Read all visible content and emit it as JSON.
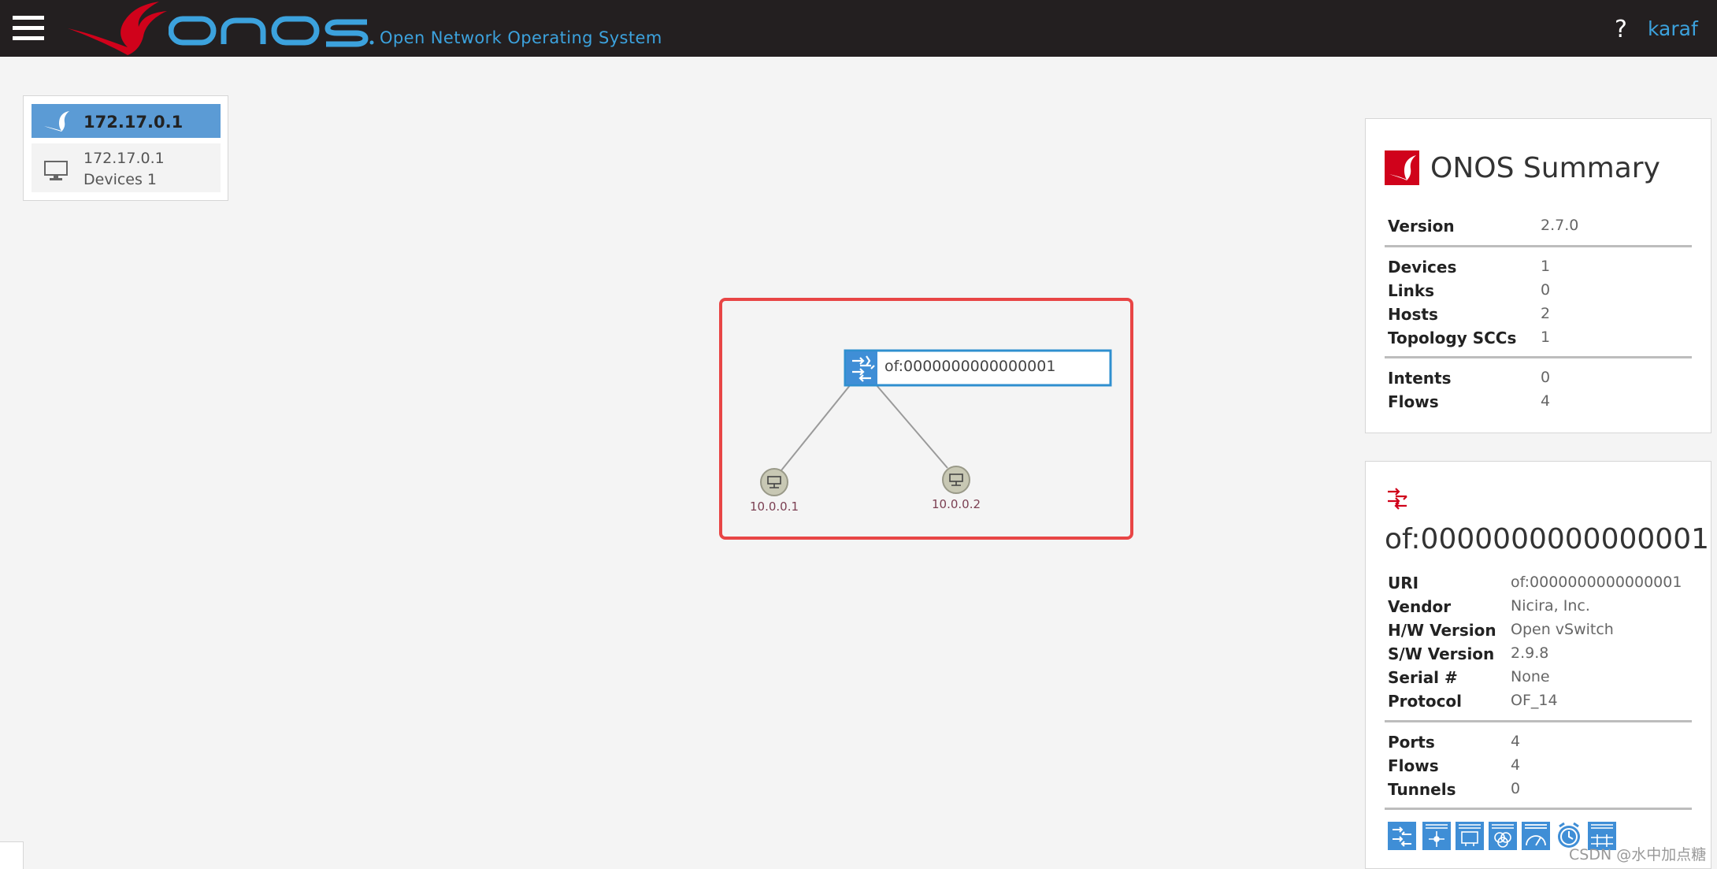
{
  "header": {
    "logo_text": "onos",
    "subtitle": "Open Network Operating System",
    "help_label": "?",
    "user": "karaf"
  },
  "instance": {
    "title": "172.17.0.1",
    "ip": "172.17.0.1",
    "devices": "Devices 1"
  },
  "topology": {
    "device_label": "of:0000000000000001",
    "hosts": [
      "10.0.0.1",
      "10.0.0.2"
    ]
  },
  "summary": {
    "title": "ONOS Summary",
    "rows": [
      {
        "label": "Version",
        "value": "2.7.0"
      },
      {
        "label": "Devices",
        "value": "1"
      },
      {
        "label": "Links",
        "value": "0"
      },
      {
        "label": "Hosts",
        "value": "2"
      },
      {
        "label": "Topology SCCs",
        "value": "1"
      },
      {
        "label": "Intents",
        "value": "0"
      },
      {
        "label": "Flows",
        "value": "4"
      }
    ]
  },
  "device": {
    "title": "of:0000000000000001",
    "rows": [
      {
        "label": "URI",
        "value": "of:0000000000000001"
      },
      {
        "label": "Vendor",
        "value": "Nicira, Inc."
      },
      {
        "label": "H/W Version",
        "value": "Open vSwitch"
      },
      {
        "label": "S/W Version",
        "value": "2.9.8"
      },
      {
        "label": "Serial #",
        "value": "None"
      },
      {
        "label": "Protocol",
        "value": "OF_14"
      },
      {
        "label": "Ports",
        "value": "4"
      },
      {
        "label": "Flows",
        "value": "4"
      },
      {
        "label": "Tunnels",
        "value": "0"
      }
    ],
    "actions": [
      "show-device-view",
      "show-flow-view",
      "show-port-view",
      "show-group-view",
      "show-meter-view",
      "show-pipeconf-view",
      "show-table-view"
    ]
  },
  "watermark": "CSDN @水中加点糖",
  "colors": {
    "header_bg": "#231f20",
    "accent_blue": "#3ca2dd",
    "brand_red": "#d0021b",
    "highlight_red": "#e84545"
  }
}
